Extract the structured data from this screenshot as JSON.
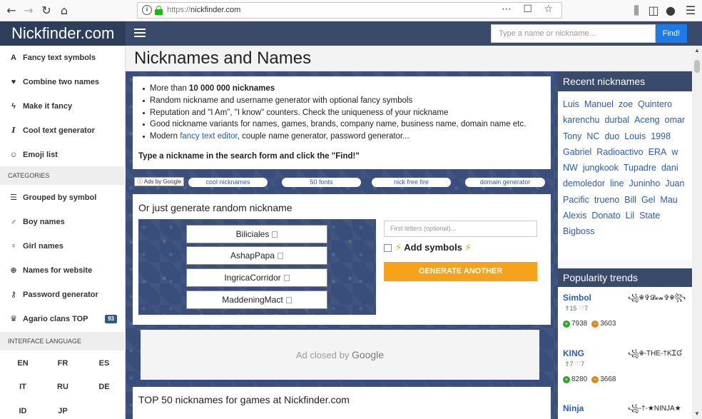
{
  "browser": {
    "url_protocol": "https://",
    "url_domain": "nickfinder.com",
    "url_right_icons": "⋯ ☐ ☆"
  },
  "sidebar": {
    "logo": "Nickfinder.com",
    "items": [
      {
        "label": "Fancy text symbols",
        "icon": "A"
      },
      {
        "label": "Combine two names",
        "icon": "♥"
      },
      {
        "label": "Make it fancy",
        "icon": "ϟ"
      },
      {
        "label": "Cool text generator",
        "icon": "I"
      },
      {
        "label": "Emoji list",
        "icon": "☺"
      }
    ],
    "categories_label": "CATEGORIES",
    "categories": [
      {
        "label": "Grouped by symbol",
        "icon": "☰"
      },
      {
        "label": "Boy names",
        "icon": "♂"
      },
      {
        "label": "Girl names",
        "icon": "♀"
      },
      {
        "label": "Names for website",
        "icon": "⊕"
      },
      {
        "label": "Password generator",
        "icon": "⚷"
      },
      {
        "label": "Agario clans TOP",
        "icon": "♛",
        "badge": "93"
      }
    ],
    "interface_label": "INTERFACE LANGUAGE",
    "languages": [
      "EN",
      "FR",
      "ES",
      "IT",
      "RU",
      "DE",
      "ID",
      "JP"
    ]
  },
  "header": {
    "search_placeholder": "Type a name or nickname...",
    "find_label": "Find!"
  },
  "main": {
    "title": "Nicknames and Names",
    "info": {
      "line1_pre": "More than ",
      "line1_bold": "10 000 000 nicknames",
      "line2": "Random nickname and username generator with optional fancy symbols",
      "line3": "Reputation and \"I Am\", \"I know\" counters. Check the uniqueness of your nickname",
      "line4": "Good nickname variants for names, games, brands, company name, business name, domain name etc.",
      "line5_pre": "Modern ",
      "line5_link": "fancy text editor",
      "line5_post": ", couple name generator, password generator...",
      "cta": "Type a nickname in the search form and click the \"Find!\""
    },
    "ads": {
      "label": "Ads by Google",
      "links": [
        "cool nicknames",
        "50 fonts",
        "nick free fire",
        "domain generator"
      ]
    },
    "generator": {
      "title": "Or just generate random nickname",
      "nicknames": [
        "Biliciales",
        "AshapPapa",
        "IngricaCorridor",
        "MaddeningMact"
      ],
      "first_letters_placeholder": "First letters (optional)...",
      "add_symbols_label": "Add symbols",
      "button_label": "GENERATE ANOTHER"
    },
    "ad_closed_pre": "Ad closed by ",
    "ad_closed_brand": "Google",
    "top50_title": "TOP 50 nicknames for games at Nickfinder.com"
  },
  "recent": {
    "title": "Recent nicknames",
    "nicknames": [
      "Luis",
      "Manuel",
      "zoe",
      "Quintero",
      "karenchu",
      "durbal",
      "Aceng",
      "omar",
      "Tony",
      "NC",
      "duo",
      "Louis",
      "1998",
      "Gabriel",
      "Radioactivo",
      "ERA",
      "w",
      "NW",
      "jungkook",
      "Tupadre",
      "dani",
      "demoledor",
      "line",
      "Juninho",
      "Juan",
      "Pacific",
      "trueno",
      "Bill",
      "Gel",
      "Mau",
      "Alexis",
      "Donato",
      "Lil",
      "State",
      "Bigboss"
    ]
  },
  "popularity": {
    "title": "Popularity trends",
    "trends": [
      {
        "name": "Simbol",
        "fancy": "꧁☬✞𝓓𝓸𝓷✞☬꧂",
        "up": "15",
        "down": "7",
        "votes_up": "7938",
        "votes_down": "3603"
      },
      {
        "name": "KING",
        "fancy": "꧁☬-THE-†KᏆƓ",
        "up": "7",
        "down": "7",
        "votes_up": "8280",
        "votes_down": "3668"
      },
      {
        "name": "Ninja",
        "fancy": "꧁-†-★NINJA★",
        "up": "",
        "down": "",
        "votes_up": "",
        "votes_down": ""
      }
    ]
  }
}
